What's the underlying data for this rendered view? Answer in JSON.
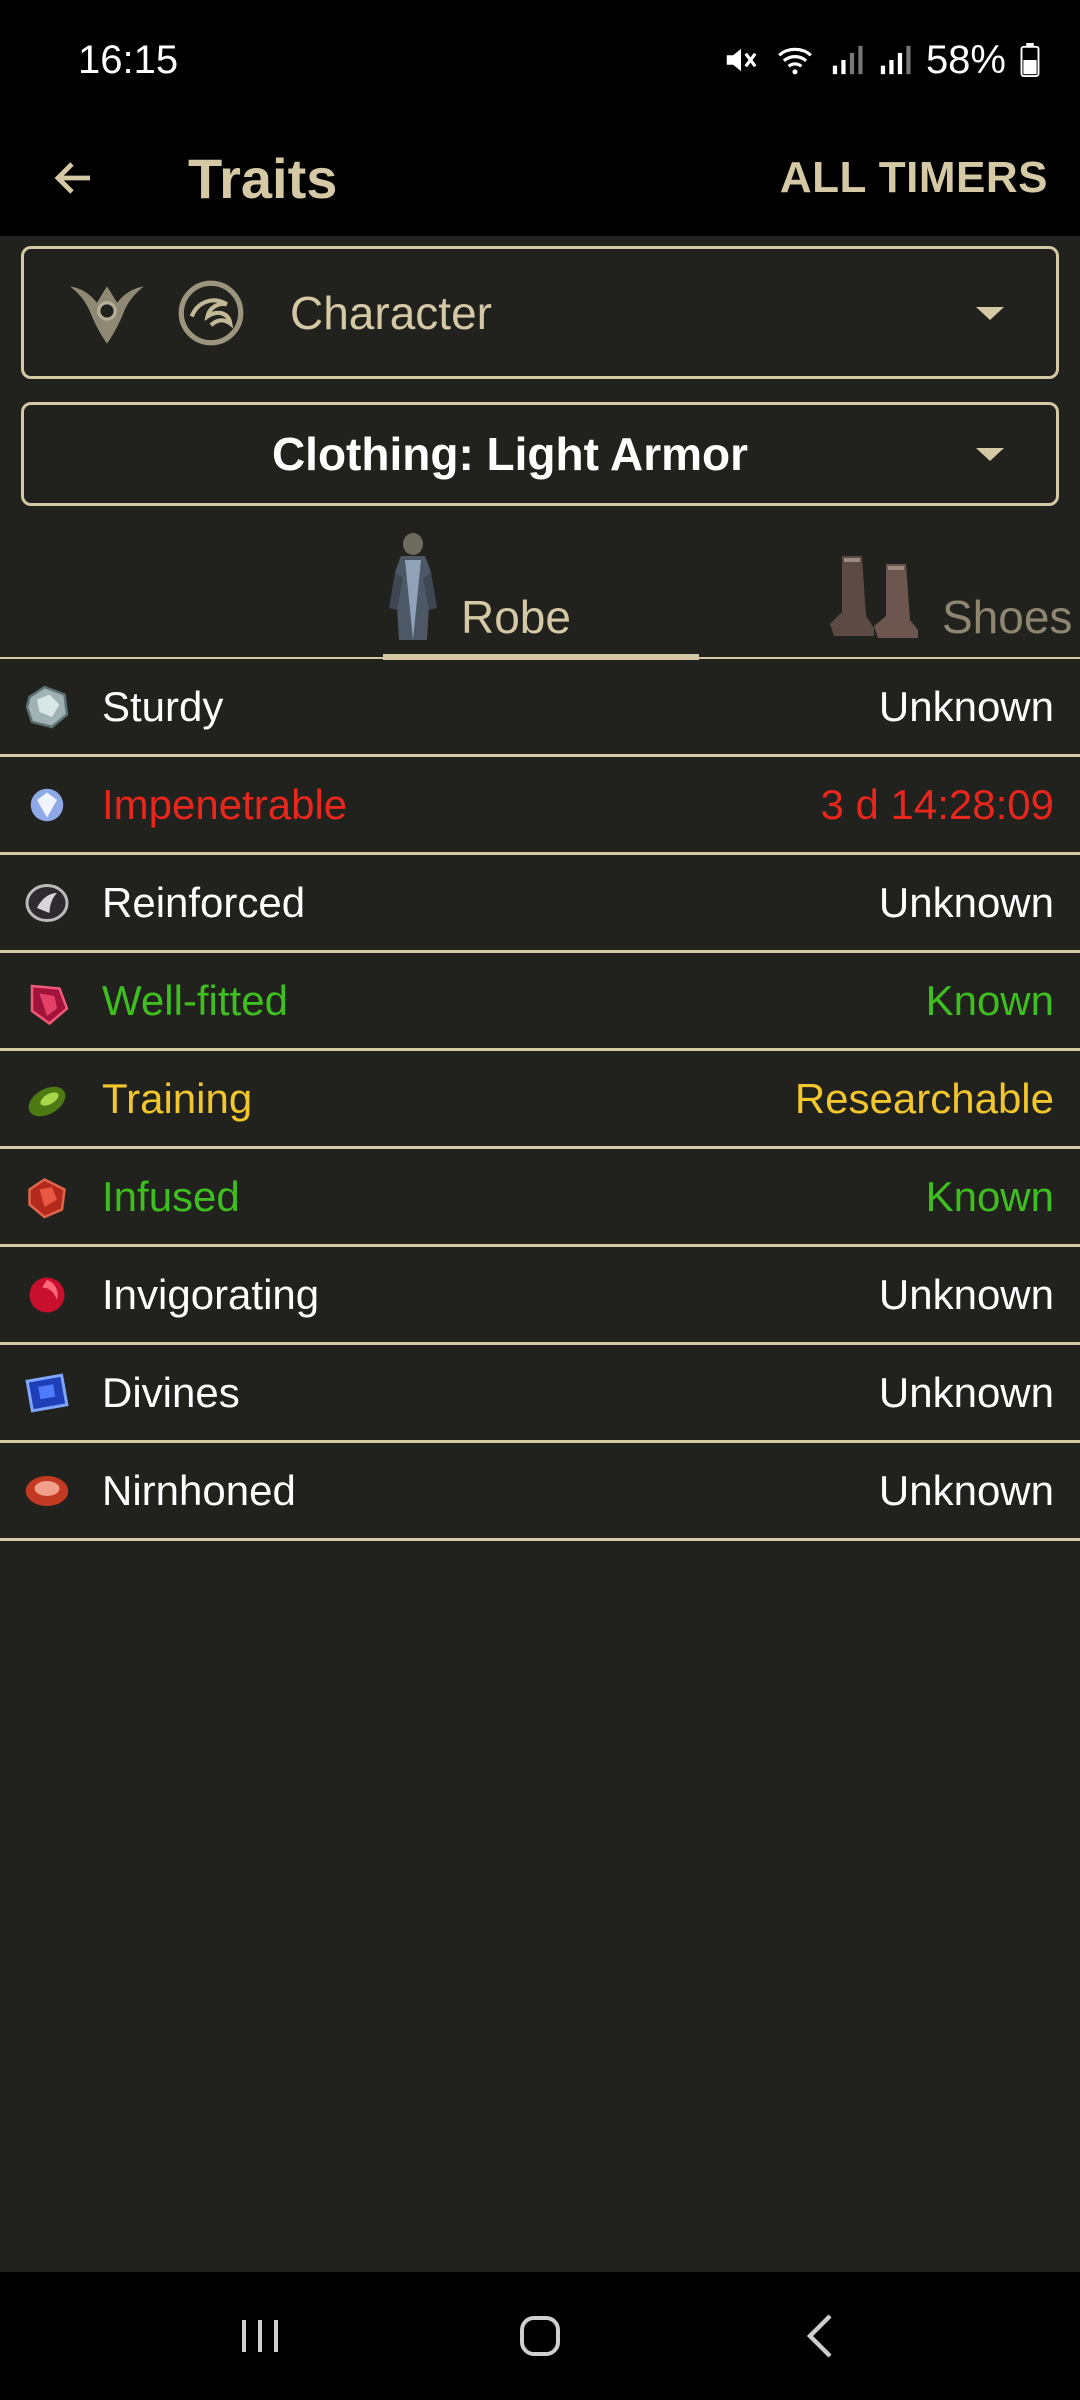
{
  "status_bar": {
    "time": "16:15",
    "battery": "58%"
  },
  "app_bar": {
    "title": "Traits",
    "action": "ALL TIMERS"
  },
  "character_select": {
    "label": "Character"
  },
  "category_select": {
    "label": "Clothing: Light Armor"
  },
  "tabs": [
    {
      "label": "Robe",
      "selected": true
    },
    {
      "label": "Shoes",
      "selected": false
    }
  ],
  "colors": {
    "accent": "#d5c8a5",
    "background": "#21211e",
    "unknown": "#ffffff",
    "timer": "#e8261c",
    "known": "#3fbf1f",
    "researchable": "#f2c62c"
  },
  "traits": [
    {
      "name": "Sturdy",
      "status": "Unknown",
      "state": "unknown",
      "icon": "quartz-gem-icon"
    },
    {
      "name": "Impenetrable",
      "status": "3 d 14:28:09",
      "state": "timer",
      "icon": "diamond-gem-icon"
    },
    {
      "name": "Reinforced",
      "status": "Unknown",
      "state": "unknown",
      "icon": "sardonyx-gem-icon"
    },
    {
      "name": "Well-fitted",
      "status": "Known",
      "state": "known",
      "icon": "almandine-gem-icon"
    },
    {
      "name": "Training",
      "status": "Researchable",
      "state": "researchable",
      "icon": "emerald-gem-icon"
    },
    {
      "name": "Infused",
      "status": "Known",
      "state": "known",
      "icon": "bloodstone-gem-icon"
    },
    {
      "name": "Invigorating",
      "status": "Unknown",
      "state": "unknown",
      "icon": "garnet-gem-icon"
    },
    {
      "name": "Divines",
      "status": "Unknown",
      "state": "unknown",
      "icon": "sapphire-gem-icon"
    },
    {
      "name": "Nirnhoned",
      "status": "Unknown",
      "state": "unknown",
      "icon": "fortified-nirncrux-icon"
    }
  ]
}
